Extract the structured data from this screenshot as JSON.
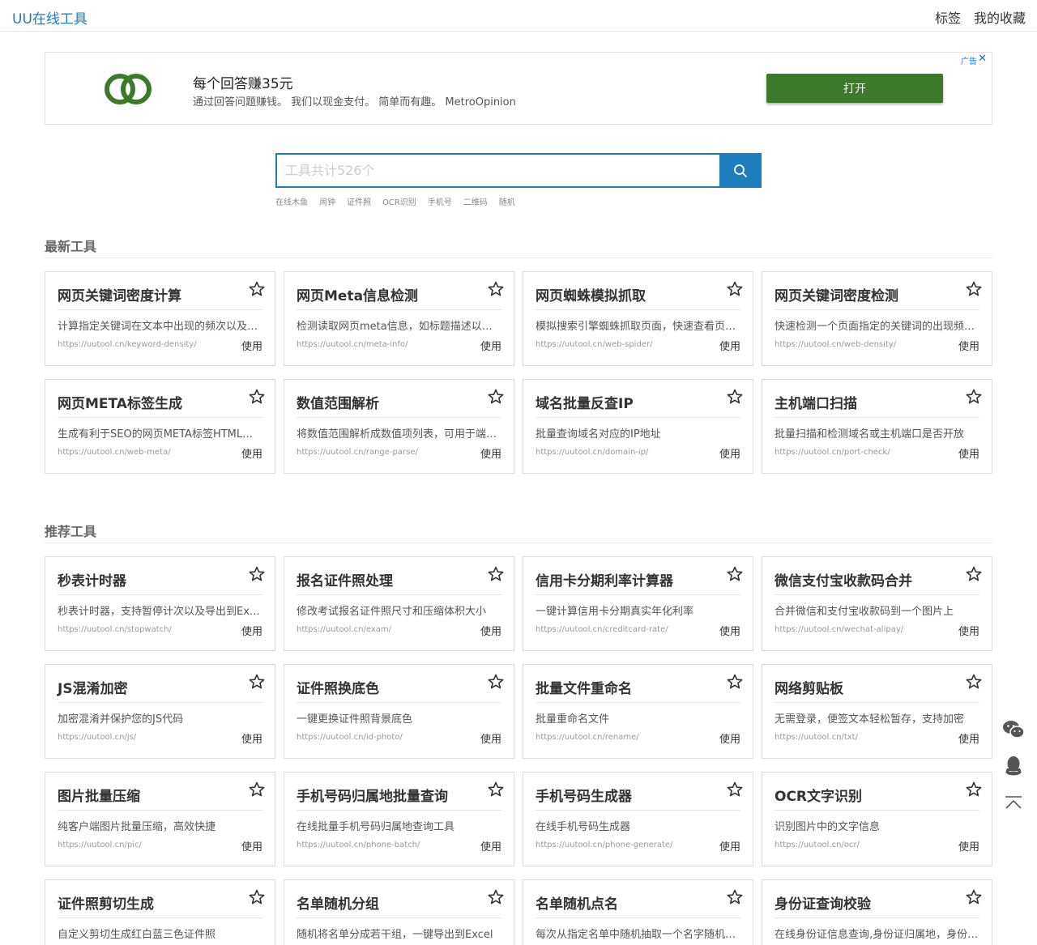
{
  "header": {
    "brand": "UU在线工具",
    "nav": [
      "标签",
      "我的收藏"
    ]
  },
  "ad": {
    "title": "每个回答赚35元",
    "description": "通过回答问题赚钱。 我们以现金支付。 简单而有趣。 MetroOpinion",
    "cta": "打开",
    "badge": "广告",
    "close_icon": "close-icon",
    "logo_color": "#3a7a2a",
    "cta_color": "#3a7a2a"
  },
  "search": {
    "placeholder": "工具共计526个",
    "button_icon": "search-icon",
    "hotwords": [
      "在线木鱼",
      "闹钟",
      "证件照",
      "OCR识别",
      "手机号",
      "二维码",
      "随机"
    ]
  },
  "sections": {
    "latest": {
      "title": "最新工具",
      "cards": [
        {
          "title": "网页关键词密度计算",
          "desc": "计算指定关键词在文本中出现的频次以及密度",
          "url": "https://uutool.cn/keyword-density/",
          "action": "使用"
        },
        {
          "title": "网页Meta信息检测",
          "desc": "检测读取网页meta信息，如标题描述以及关键词",
          "url": "https://uutool.cn/meta-info/",
          "action": "使用"
        },
        {
          "title": "网页蜘蛛模拟抓取",
          "desc": "模拟搜索引擎蜘蛛抓取页面，快速查看页面内容",
          "url": "https://uutool.cn/web-spider/",
          "action": "使用"
        },
        {
          "title": "网页关键词密度检测",
          "desc": "快速检测一个页面指定的关键词的出现频次与密度",
          "url": "https://uutool.cn/web-density/",
          "action": "使用"
        },
        {
          "title": "网页META标签生成",
          "desc": "生成有利于SEO的网页META标签HTML代码",
          "url": "https://uutool.cn/web-meta/",
          "action": "使用"
        },
        {
          "title": "数值范围解析",
          "desc": "将数值范围解析成数值项列表，可用于端口范围",
          "url": "https://uutool.cn/range-parse/",
          "action": "使用"
        },
        {
          "title": "域名批量反查IP",
          "desc": "批量查询域名对应的IP地址",
          "url": "https://uutool.cn/domain-ip/",
          "action": "使用"
        },
        {
          "title": "主机端口扫描",
          "desc": "批量扫描和检测域名或主机端口是否开放",
          "url": "https://uutool.cn/port-check/",
          "action": "使用"
        }
      ]
    },
    "recommended": {
      "title": "推荐工具",
      "cards": [
        {
          "title": "秒表计时器",
          "desc": "秒表计时器，支持暂停计次以及导出到Excel",
          "url": "https://uutool.cn/stopwatch/",
          "action": "使用"
        },
        {
          "title": "报名证件照处理",
          "desc": "修改考试报名证件照尺寸和压缩体积大小",
          "url": "https://uutool.cn/exam/",
          "action": "使用"
        },
        {
          "title": "信用卡分期利率计算器",
          "desc": "一键计算信用卡分期真实年化利率",
          "url": "https://uutool.cn/creditcard-rate/",
          "action": "使用"
        },
        {
          "title": "微信支付宝收款码合并",
          "desc": "合并微信和支付宝收款码到一个图片上",
          "url": "https://uutool.cn/wechat-alipay/",
          "action": "使用"
        },
        {
          "title": "JS混淆加密",
          "desc": "加密混淆并保护您的JS代码",
          "url": "https://uutool.cn/js/",
          "action": "使用"
        },
        {
          "title": "证件照换底色",
          "desc": "一键更换证件照背景底色",
          "url": "https://uutool.cn/id-photo/",
          "action": "使用"
        },
        {
          "title": "批量文件重命名",
          "desc": "批量重命名文件",
          "url": "https://uutool.cn/rename/",
          "action": "使用"
        },
        {
          "title": "网络剪贴板",
          "desc": "无需登录，便签文本轻松暂存，支持加密",
          "url": "https://uutool.cn/txt/",
          "action": "使用"
        },
        {
          "title": "图片批量压缩",
          "desc": "纯客户端图片批量压缩，高效快捷",
          "url": "https://uutool.cn/pic/",
          "action": "使用"
        },
        {
          "title": "手机号码归属地批量查询",
          "desc": "在线批量手机号码归属地查询工具",
          "url": "https://uutool.cn/phone-batch/",
          "action": "使用"
        },
        {
          "title": "手机号码生成器",
          "desc": "在线手机号码生成器",
          "url": "https://uutool.cn/phone-generate/",
          "action": "使用"
        },
        {
          "title": "OCR文字识别",
          "desc": "识别图片中的文字信息",
          "url": "https://uutool.cn/ocr/",
          "action": "使用"
        },
        {
          "title": "证件照剪切生成",
          "desc": "自定义剪切生成红白蓝三色证件照",
          "url": "",
          "action": ""
        },
        {
          "title": "名单随机分组",
          "desc": "随机将名单分成若干组，一键导出到Excel",
          "url": "",
          "action": ""
        },
        {
          "title": "名单随机点名",
          "desc": "每次从指定名单中随机抽取一个名字随机点名",
          "url": "",
          "action": ""
        },
        {
          "title": "身份证查询校验",
          "desc": "在线身份证信息查询,身份证归属地，身份证校验",
          "url": "",
          "action": ""
        }
      ]
    }
  },
  "side_tools": [
    "wechat-icon",
    "qq-icon",
    "back-to-top-icon"
  ],
  "colors": {
    "brand": "#1c7ebd",
    "text": "#333333",
    "muted": "#999999",
    "border": "#dddddd"
  }
}
